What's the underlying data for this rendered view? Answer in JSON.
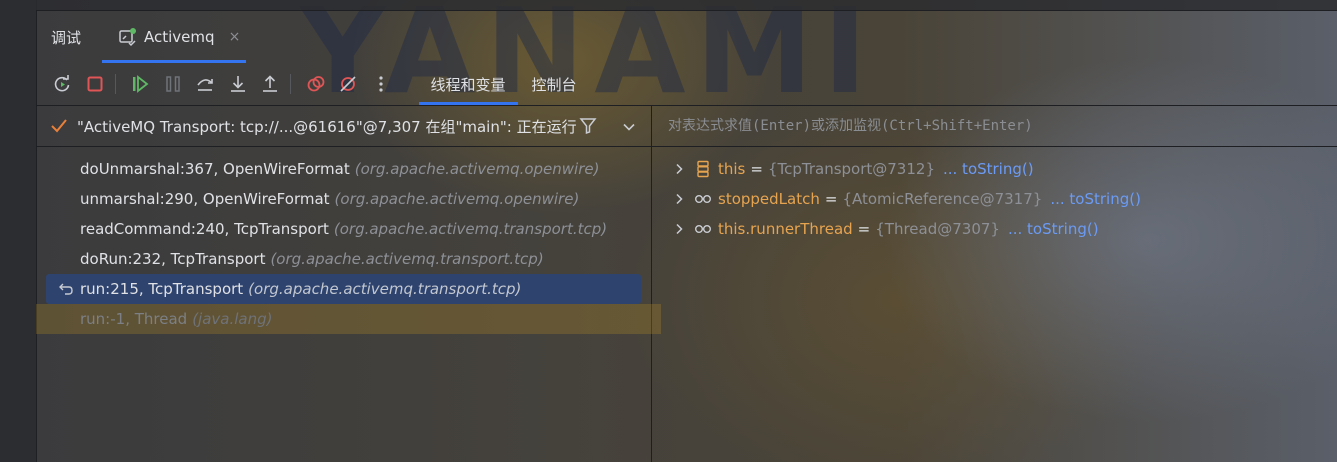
{
  "window": {
    "tool_title": "调试",
    "run_tab": {
      "label": "Activemq",
      "close": "×"
    }
  },
  "toolbar": {
    "buttons": [
      {
        "name": "rerun-icon",
        "color": "#5fb865"
      },
      {
        "name": "stop-icon",
        "color": "#e05555"
      },
      {
        "name": "resume-icon",
        "color": "#5fb865"
      },
      {
        "name": "pause-icon",
        "color": "#6f737a"
      },
      {
        "name": "step-over-icon",
        "color": "#c9ccd2"
      },
      {
        "name": "step-into-icon",
        "color": "#c9ccd2"
      },
      {
        "name": "step-out-icon",
        "color": "#c9ccd2"
      },
      {
        "name": "view-breakpoints-icon",
        "color": "#e05555"
      },
      {
        "name": "mute-breakpoints-icon",
        "color": "#e05555"
      },
      {
        "name": "more-icon",
        "color": "#c9ccd2"
      }
    ],
    "tabs": [
      {
        "label": "线程和变量",
        "active": true
      },
      {
        "label": "控制台",
        "active": false
      }
    ]
  },
  "thread_selector": {
    "label": "\"ActiveMQ Transport: tcp://...@61616\"@7,307 在组\"main\": 正在运行"
  },
  "frames": [
    {
      "method": "doUnmarshal:367, OpenWireFormat",
      "package": "(org.apache.activemq.openwire)"
    },
    {
      "method": "unmarshal:290, OpenWireFormat",
      "package": "(org.apache.activemq.openwire)"
    },
    {
      "method": "readCommand:240, TcpTransport",
      "package": "(org.apache.activemq.transport.tcp)"
    },
    {
      "method": "doRun:232, TcpTransport",
      "package": "(org.apache.activemq.transport.tcp)"
    },
    {
      "method": "run:215, TcpTransport",
      "package": "(org.apache.activemq.transport.tcp)"
    },
    {
      "method": "run:-1, Thread",
      "package": "(java.lang)"
    }
  ],
  "evaluate": {
    "placeholder": "对表达式求值(Enter)或添加监视(Ctrl+Shift+Enter)"
  },
  "variables": [
    {
      "name": "this",
      "eq": "=",
      "value": "{TcpTransport@7312}",
      "link": "... toString()",
      "icon": "field-icon"
    },
    {
      "name": "stoppedLatch",
      "eq": "=",
      "value": "{AtomicReference@7317}",
      "link": "... toString()",
      "icon": "watch-icon"
    },
    {
      "name": "this.runnerThread",
      "eq": "=",
      "value": "{Thread@7307}",
      "link": "... toString()",
      "icon": "watch-icon"
    }
  ],
  "colors": {
    "accent": "#3574f0",
    "selected_frame": "#2e436e",
    "var_name": "#e6a450",
    "link": "#6b9bf5"
  }
}
